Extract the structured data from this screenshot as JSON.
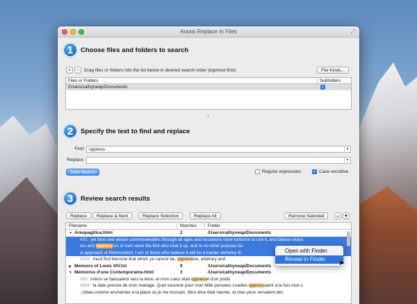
{
  "window": {
    "title": "Araxis Replace In Files"
  },
  "step1": {
    "number": "1",
    "title": "Choose files and folders to search",
    "add_label": "+",
    "remove_label": "−",
    "hint": "Drag files or folders into the list below in desired search order (topmost first):",
    "file_kinds_label": "File Kinds...",
    "table": {
      "headers": [
        "Files or Folders",
        "Subfolders"
      ],
      "rows": [
        {
          "path": "/Users/cathyneap/Documents",
          "subfolders": true
        }
      ]
    }
  },
  "step2": {
    "number": "2",
    "title": "Specify the text to find and replace",
    "find_label": "Find",
    "find_value": "oppress",
    "replace_label": "Replace",
    "replace_value": "",
    "start_search_label": "Start Search",
    "regex_label": "Regular expression",
    "regex_checked": false,
    "case_label": "Case sensitive",
    "case_checked": true
  },
  "step3": {
    "number": "3",
    "title": "Review search results",
    "buttons": {
      "replace": "Replace",
      "replace_next": "Replace & Next",
      "replace_selection": "Replace Selection",
      "replace_all": "Replace All",
      "remove_selected": "Remove Selected",
      "up": "▲",
      "down": "▼"
    },
    "headers": {
      "filename": "Filename",
      "matches": "Matches",
      "folder": "Folder"
    },
    "files": [
      {
        "name": "Areopagitica.html",
        "matches": "2",
        "folder": "/Users/cathyneap/Documents",
        "expanded": true
      },
      {
        "name": "Memoirs of Louis XIV.txt",
        "matches": "9",
        "folder": "/Users/cathyneap/Documents",
        "expanded": false
      },
      {
        "name": "Mémoires d'une Contemporaine.html",
        "matches": "3",
        "folder": "/Users/cathyneap/Documents",
        "expanded": true
      }
    ],
    "snippets": {
      "a1_line": "480:",
      "a1_text1": "yet best and wisest commonwealths through all ages and occasions have forborne to use it, and falsest seduc",
      "a1_text2a": "ers and ",
      "a1_hl": "oppress",
      "a1_text2b": "ors of men were the first who took it up, and to no other purpose bu",
      "a1_text3": "st approach of Reformation; I am of those who believe it will be a harder alchemy th",
      "a2_line": "1542:",
      "a2_text_a": "must first become that which ye cannot be, ",
      "a2_hl": "oppress",
      "a2_text_b": "ive, arbitrary and",
      "m1_line": "359:",
      "m1_text_a": "miens se baissaient vers la terre, et mon cœur était ",
      "m1_hl": "oppress",
      "m1_text_b": "é d'un poids",
      "m2_line": "1664:",
      "m2_text_a": "la date précise de mon mariage. Quel souvenir pour moi! Mille pensées cruelles ",
      "m2_hl": "oppress",
      "m2_text_b": "aient à la fois mon c",
      "m3_text": "; j'étais comme enchaînée à la place où je me trouvais. Mon âme était navrée, et mes yeux versaient des"
    }
  },
  "context_menu": {
    "items": [
      "Open with Finder",
      "Reveal in Finder"
    ],
    "active_index": 1
  }
}
